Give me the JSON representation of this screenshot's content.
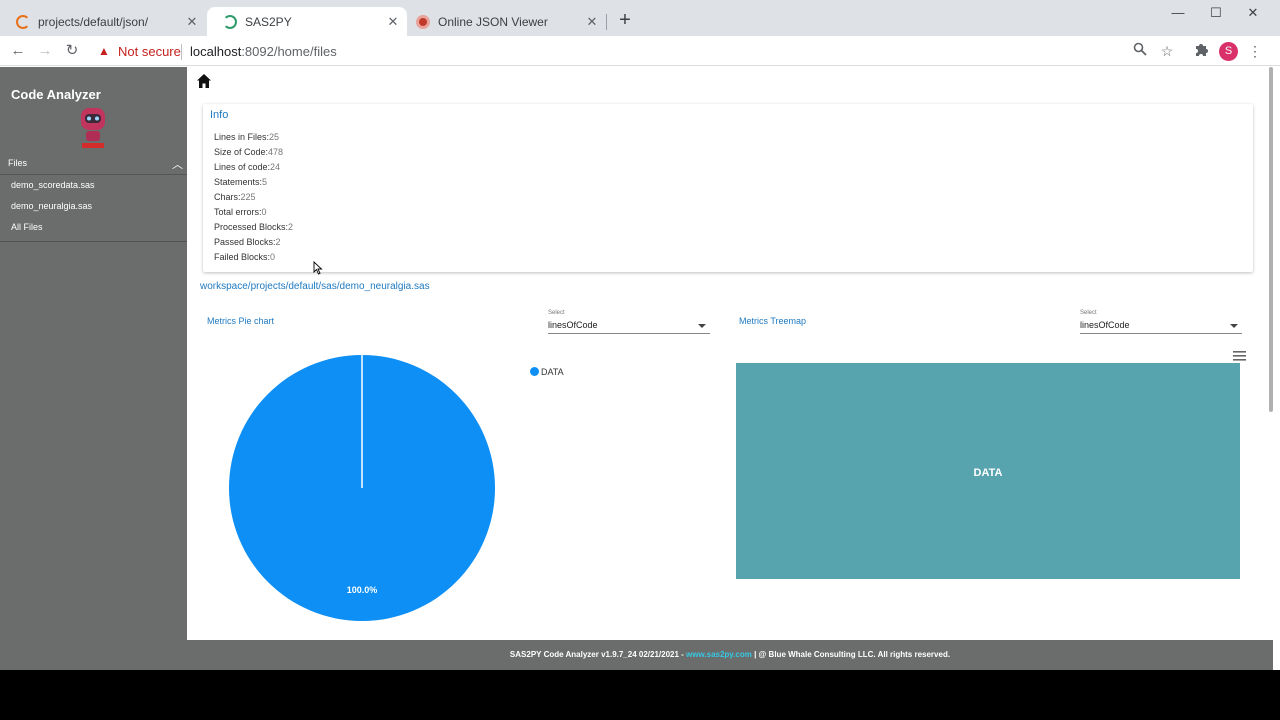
{
  "browser": {
    "tabs": [
      {
        "title": "projects/default/json/",
        "favicon_color": "#e8711a"
      },
      {
        "title": "SAS2PY",
        "favicon_color": "#2e9b6a"
      },
      {
        "title": "Online JSON Viewer",
        "favicon_color": "#c0392b"
      }
    ],
    "security_label": "Not secure",
    "url_host": "localhost",
    "url_rest": ":8092/home/files",
    "profile_initial": "S"
  },
  "sidebar": {
    "app_name": "Code Analyzer",
    "files_label": "Files",
    "items": [
      "demo_scoredata.sas",
      "demo_neuralgia.sas",
      "All Files"
    ]
  },
  "info": {
    "title": "Info",
    "stats": [
      {
        "label": "Lines in Files:",
        "value": "25"
      },
      {
        "label": "Size of Code:",
        "value": "478"
      },
      {
        "label": "Lines of code:",
        "value": "24"
      },
      {
        "label": "Statements:",
        "value": "5"
      },
      {
        "label": "Chars:",
        "value": "225"
      },
      {
        "label": "Total errors:",
        "value": "0"
      },
      {
        "label": "Processed Blocks:",
        "value": "2"
      },
      {
        "label": "Passed Blocks:",
        "value": "2"
      },
      {
        "label": "Failed Blocks:",
        "value": "0"
      }
    ]
  },
  "file_path": "workspace/projects/default/sas/demo_neuralgia.sas",
  "pie_panel": {
    "title": "Metrics Pie chart",
    "select_label": "Select",
    "select_value": "linesOfCode",
    "legend": "DATA",
    "slice_label": "100.0%",
    "color": "#0d8ff5"
  },
  "treemap_panel": {
    "title": "Metrics Treemap",
    "select_label": "Select",
    "select_value": "linesOfCode",
    "block_label": "DATA",
    "color": "#57a3ae"
  },
  "footer": {
    "prefix": "SAS2PY Code Analyzer v1.9.7_24 02/21/2021 - ",
    "link": "www.sas2py.com",
    "suffix": " | @ Blue Whale Consulting LLC. All rights reserved."
  }
}
